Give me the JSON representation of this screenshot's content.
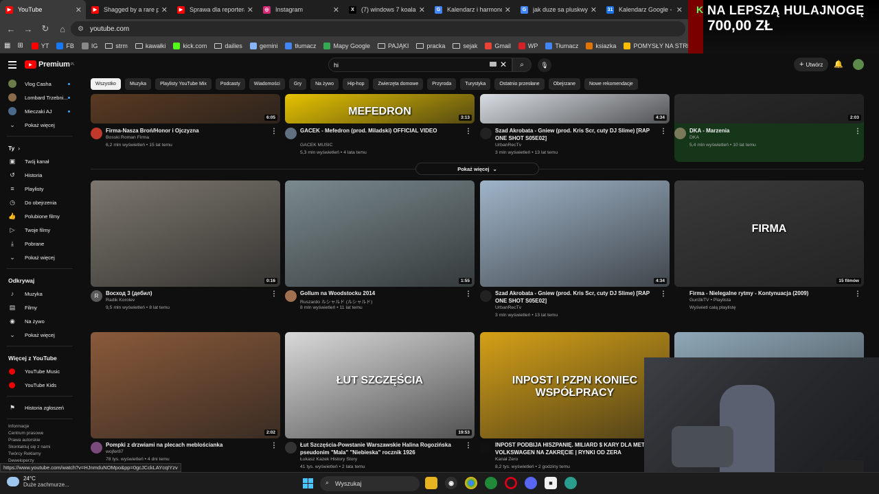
{
  "tabs": [
    {
      "title": "YouTube",
      "icon": "youtube-icon",
      "color": "#ff0000",
      "glyph": "▶"
    },
    {
      "title": "Shagged by a rare pa",
      "icon": "youtube-icon",
      "color": "#ff0000",
      "glyph": "▶"
    },
    {
      "title": "Sprawa dla reportera",
      "icon": "youtube-icon",
      "color": "#ff0000",
      "glyph": "▶"
    },
    {
      "title": "Instagram",
      "icon": "instagram-icon",
      "color": "#d62976",
      "glyph": "◎"
    },
    {
      "title": "(7) windows 7 koala w",
      "icon": "x-icon",
      "color": "#000000",
      "glyph": "X"
    },
    {
      "title": "Kalendarz i harmonog",
      "icon": "google-icon",
      "color": "#4285f4",
      "glyph": "G"
    },
    {
      "title": "jak duze sa pluskwy\\",
      "icon": "google-icon",
      "color": "#4285f4",
      "glyph": "G"
    },
    {
      "title": "Kalendarz Google - s",
      "icon": "calendar-icon",
      "color": "#1a73e8",
      "glyph": "31"
    }
  ],
  "address": {
    "url": "youtube.com"
  },
  "bookmarks": [
    {
      "label": "YT",
      "icon": "youtube-icon",
      "color": "#ff0000",
      "kind": "icon"
    },
    {
      "label": "FB",
      "icon": "facebook-icon",
      "color": "#1877f2",
      "kind": "icon"
    },
    {
      "label": "IG",
      "icon": "instagram-icon",
      "color": "#888888",
      "kind": "icon"
    },
    {
      "label": "strm",
      "icon": "folder-icon",
      "kind": "folder"
    },
    {
      "label": "kawałki",
      "icon": "folder-icon",
      "kind": "folder"
    },
    {
      "label": "kick.com",
      "icon": "kick-icon",
      "color": "#53fc18",
      "kind": "icon"
    },
    {
      "label": "dailies",
      "icon": "folder-icon",
      "kind": "folder"
    },
    {
      "label": "gemini",
      "icon": "gemini-icon",
      "color": "#8ab4f8",
      "kind": "icon"
    },
    {
      "label": "tłumacz",
      "icon": "translate-icon",
      "color": "#4285f4",
      "kind": "icon"
    },
    {
      "label": "Mapy Google",
      "icon": "maps-icon",
      "color": "#34a853",
      "kind": "icon"
    },
    {
      "label": "PAJĄKI",
      "icon": "folder-icon",
      "kind": "folder"
    },
    {
      "label": "pracka",
      "icon": "folder-icon",
      "kind": "folder"
    },
    {
      "label": "sejak",
      "icon": "folder-icon",
      "kind": "folder"
    },
    {
      "label": "Gmail",
      "icon": "gmail-icon",
      "color": "#ea4335",
      "kind": "icon"
    },
    {
      "label": "WP",
      "icon": "wp-icon",
      "color": "#d61f26",
      "kind": "icon"
    },
    {
      "label": "Tłumacz",
      "icon": "translate-icon",
      "color": "#4285f4",
      "kind": "icon"
    },
    {
      "label": "ksiazka",
      "icon": "book-icon",
      "color": "#e37400",
      "kind": "icon"
    },
    {
      "label": "POMYSŁY NA STRE...",
      "icon": "keep-icon",
      "color": "#fbbc04",
      "kind": "icon"
    }
  ],
  "overlay_ad": {
    "line1": "NA LEPSZĄ HULAJNOGĘ",
    "line2": "700,00 ZŁ"
  },
  "header": {
    "brand": "Premium",
    "region": "PL",
    "search_value": "hi",
    "create_label": "Utwórz"
  },
  "sidebar": {
    "subscriptions": [
      {
        "label": "Vlog Casha",
        "color": "#6b7b4a"
      },
      {
        "label": "Lombard Trzebni...",
        "color": "#8a6a4a"
      },
      {
        "label": "Mieczaki AJ",
        "color": "#4a6a8a"
      }
    ],
    "show_more": "Pokaż więcej",
    "you_heading": "Ty",
    "you_items": [
      {
        "label": "Twój kanał",
        "icon": "channel-icon",
        "glyph": "▣"
      },
      {
        "label": "Historia",
        "icon": "history-icon",
        "glyph": "↺"
      },
      {
        "label": "Playlisty",
        "icon": "playlist-icon",
        "glyph": "≡"
      },
      {
        "label": "Do obejrzenia",
        "icon": "watch-later-icon",
        "glyph": "◷"
      },
      {
        "label": "Polubione filmy",
        "icon": "like-icon",
        "glyph": "👍"
      },
      {
        "label": "Twoje filmy",
        "icon": "your-videos-icon",
        "glyph": "▷"
      },
      {
        "label": "Pobrane",
        "icon": "download-icon",
        "glyph": "⤓"
      },
      {
        "label": "Pokaż więcej",
        "icon": "chevron-down-icon",
        "glyph": "⌄"
      }
    ],
    "explore_heading": "Odkrywaj",
    "explore_items": [
      {
        "label": "Muzyka",
        "icon": "music-icon",
        "glyph": "♪"
      },
      {
        "label": "Filmy",
        "icon": "movies-icon",
        "glyph": "▤"
      },
      {
        "label": "Na żywo",
        "icon": "live-icon",
        "glyph": "◉"
      },
      {
        "label": "Pokaż więcej",
        "icon": "chevron-down-icon",
        "glyph": "⌄"
      }
    ],
    "more_heading": "Więcej z YouTube",
    "more_items": [
      {
        "label": "YouTube Music",
        "icon": "youtube-music-icon"
      },
      {
        "label": "YouTube Kids",
        "icon": "youtube-kids-icon"
      }
    ],
    "report_history": "Historia zgłoszeń",
    "footer": [
      "Informacje",
      "Centrum prasowe",
      "Prawa autorskie",
      "Skontaktuj się z nami",
      "Twórcy  Reklamy",
      "Deweloperzy"
    ]
  },
  "chips": [
    "Wszystko",
    "Muzyka",
    "Playlisty YouTube Mix",
    "Podcasty",
    "Wiadomości",
    "Gry",
    "Na żywo",
    "Hip-hop",
    "Zwierzęta domowe",
    "Przyroda",
    "Turystyka",
    "Ostatnio przesłane",
    "Obejrzane",
    "Nowe rekomendacje"
  ],
  "row1": [
    {
      "title": "Firma-Nasza Broń/Honor i Ojczyzna",
      "channel": "Bosski Roman Firma",
      "meta": "6,2 mln wyświetleń • 15 lat temu",
      "duration": "6:05",
      "thumb": "#5a3a22",
      "avatar": "#c0392b"
    },
    {
      "title": "GACEK - Mefedron (prod. Miladski) OFFICIAL VIDEO",
      "channel": "GACEK MUSIC",
      "meta": "5,3 mln wyświetleń • 4 lata temu",
      "duration": "3:13",
      "thumb": "#e6c200",
      "overlay": "MEFEDRON",
      "avatar": "#607080"
    },
    {
      "title": "Szad Akrobata - Gniew (prod. Kris Scr, cuty DJ Slime) [RAP ONE SHOT S05E02]",
      "channel": "UrbanRecTv",
      "meta": "3 mln wyświetleń • 13 lat temu",
      "duration": "4:34",
      "thumb": "#d8dde3",
      "avatar": "#222222"
    },
    {
      "title": "DKA - Marzenia",
      "channel": "DKA",
      "meta": "5,4 mln wyświetleń • 10 lat temu",
      "duration": "2:03",
      "thumb": "#2a2a2a",
      "avatar": "#7a7a5a"
    }
  ],
  "show_more_button": "Pokaż więcej",
  "row2": [
    {
      "title": "Восход 3 (дебил)",
      "channel": "Radik Korolev",
      "meta": "9,5 mln wyświetleń • 8 lat temu",
      "duration": "0:16",
      "thumb": "#7c776e",
      "avatar": "#5a5a5a",
      "initial": "R"
    },
    {
      "title": "Gollum na Woodstocku 2014",
      "channel": "Ruszardo ルシャルド (ルシャルド)",
      "meta": "8 mln wyświetleń • 11 lat temu",
      "duration": "1:55",
      "thumb": "#7a8a8e",
      "avatar": "#a07050"
    },
    {
      "title": "Szad Akrobata - Gniew (prod. Kris Scr, cuty DJ Slime) [RAP ONE SHOT S05E02]",
      "channel": "UrbanRecTv",
      "meta": "3 mln wyświetleń • 13 lat temu",
      "duration": "4:34",
      "thumb": "#9fb4c8",
      "avatar": "#222222"
    },
    {
      "title": "Firma - Nielegalne rytmy - Kontynuacja (2009)",
      "channel": "Gun3kTV • Playlista",
      "meta": "Wyświetl całą playlistę",
      "duration": "15 filmów",
      "thumb": "#3a3a3a",
      "overlay": "FIRMA",
      "avatar": ""
    }
  ],
  "row3": [
    {
      "title": "Pompki z drzwiami na plecach meblościanka",
      "channel": "wojfer87",
      "meta": "78 tys. wyświetleń • 4 dni temu",
      "duration": "2:02",
      "thumb": "#8a5a3a",
      "avatar": "#7a4a7a"
    },
    {
      "title": "Łut Szczęścia-Powstanie Warszawskie Halina Rogozińska pseudonim \"Mala\" \"Niebieska\" rocznik 1926",
      "channel": "Łukasz Kazek History Story",
      "meta": "41 tys. wyświetleń • 2 lata temu",
      "duration": "19:53",
      "thumb": "#d9d9d9",
      "overlay": "ŁUT SZCZĘŚCIA",
      "avatar": "#333333"
    },
    {
      "title": "INPOST PODBIJA HISZPANIĘ. MILIARD $ KARY DLA METY. VOLKSWAGEN NA ZAKRĘCIE | RYNKI OD ZERA",
      "channel": "Kanał Zero",
      "meta": "8,2 tys. wyświetleń • 2 godziny temu",
      "duration": "",
      "thumb": "#d4a017",
      "overlay": "INPOST I PZPN KONIEC WSPÓŁPRACY",
      "avatar": "#111111"
    },
    {
      "title": "",
      "channel": "",
      "meta": "",
      "duration": "",
      "thumb": "#8fa8b8",
      "avatar": ""
    }
  ],
  "status_url": "https://www.youtube.com/watch?v=HJnmduNOMpo&pp=0gcJCckLAYcqIYzv",
  "taskbar": {
    "temperature": "24°C",
    "weather_text": "Duże zachmurze...",
    "search_placeholder": "Wyszukaj"
  }
}
